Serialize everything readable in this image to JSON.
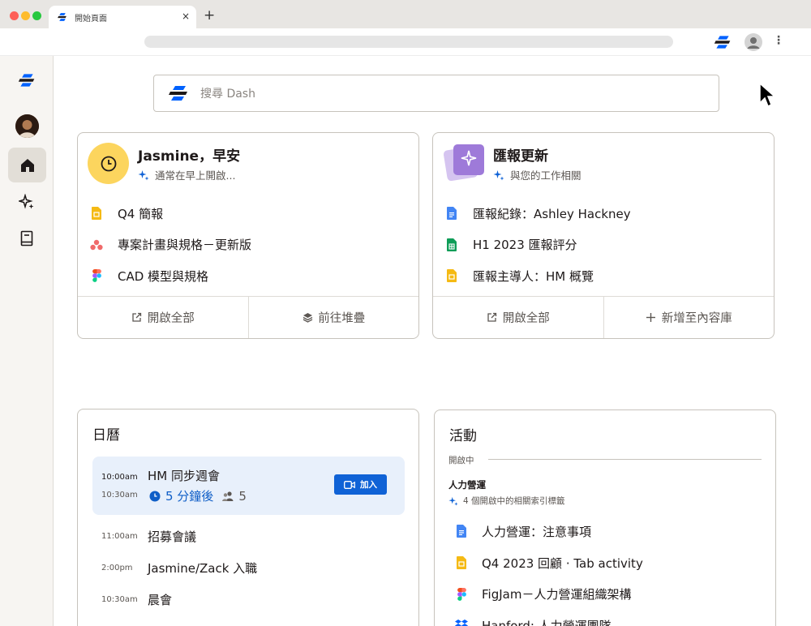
{
  "browser": {
    "tab_title": "開始頁面",
    "tab_close": "×",
    "new_tab": "+",
    "menu": "⋮"
  },
  "search": {
    "placeholder": "搜尋 Dash"
  },
  "greeting_card": {
    "title": "Jasmine，早安",
    "subtitle": "通常在早上開啟...",
    "files": [
      {
        "name": "Q4 簡報",
        "icon": "slides-icon"
      },
      {
        "name": "專案計畫與規格－更新版",
        "icon": "asana-icon"
      },
      {
        "name": "CAD 模型與規格",
        "icon": "figma-icon"
      }
    ],
    "open_all": "開啟全部",
    "go_to_stack": "前往堆疊"
  },
  "report_card": {
    "title": "匯報更新",
    "subtitle": "與您的工作相關",
    "files": [
      {
        "name": "匯報紀錄：Ashley Hackney",
        "icon": "docs-icon"
      },
      {
        "name": "H1 2023 匯報評分",
        "icon": "sheets-icon"
      },
      {
        "name": "匯報主導人：HM 概覽",
        "icon": "slides-icon"
      }
    ],
    "open_all": "開啟全部",
    "add_to_library": "新增至內容庫"
  },
  "calendar": {
    "title": "日曆",
    "highlight": {
      "start": "10:00am",
      "end": "10:30am",
      "title": "HM 同步週會",
      "starts_in": "5 分鐘後",
      "attendees": "5",
      "join": "加入"
    },
    "events": [
      {
        "time": "11:00am",
        "name": "招募會議"
      },
      {
        "time": "2:00pm",
        "name": "Jasmine/Zack 入職"
      },
      {
        "time": "10:30am",
        "name": "晨會"
      }
    ]
  },
  "activity": {
    "title": "活動",
    "group_label": "開啟中",
    "heading": "人力營運",
    "subheading": "4 個開啟中的相關索引標籤",
    "items": [
      {
        "name": "人力營運：注意事項",
        "icon": "docs-icon"
      },
      {
        "name": "Q4 2023 回顧 · Tab activity",
        "icon": "slides-icon"
      },
      {
        "name": "FigJam－人力營運組織架構",
        "icon": "figma-icon"
      },
      {
        "name": "Hanford: 人力營運團隊",
        "icon": "dropbox-icon"
      }
    ]
  },
  "colors": {
    "accent": "#0f62d6",
    "greeting_circle": "#fcd55e",
    "event_highlight": "#e8f0fb",
    "stack_purple": "#9e7ad9"
  }
}
